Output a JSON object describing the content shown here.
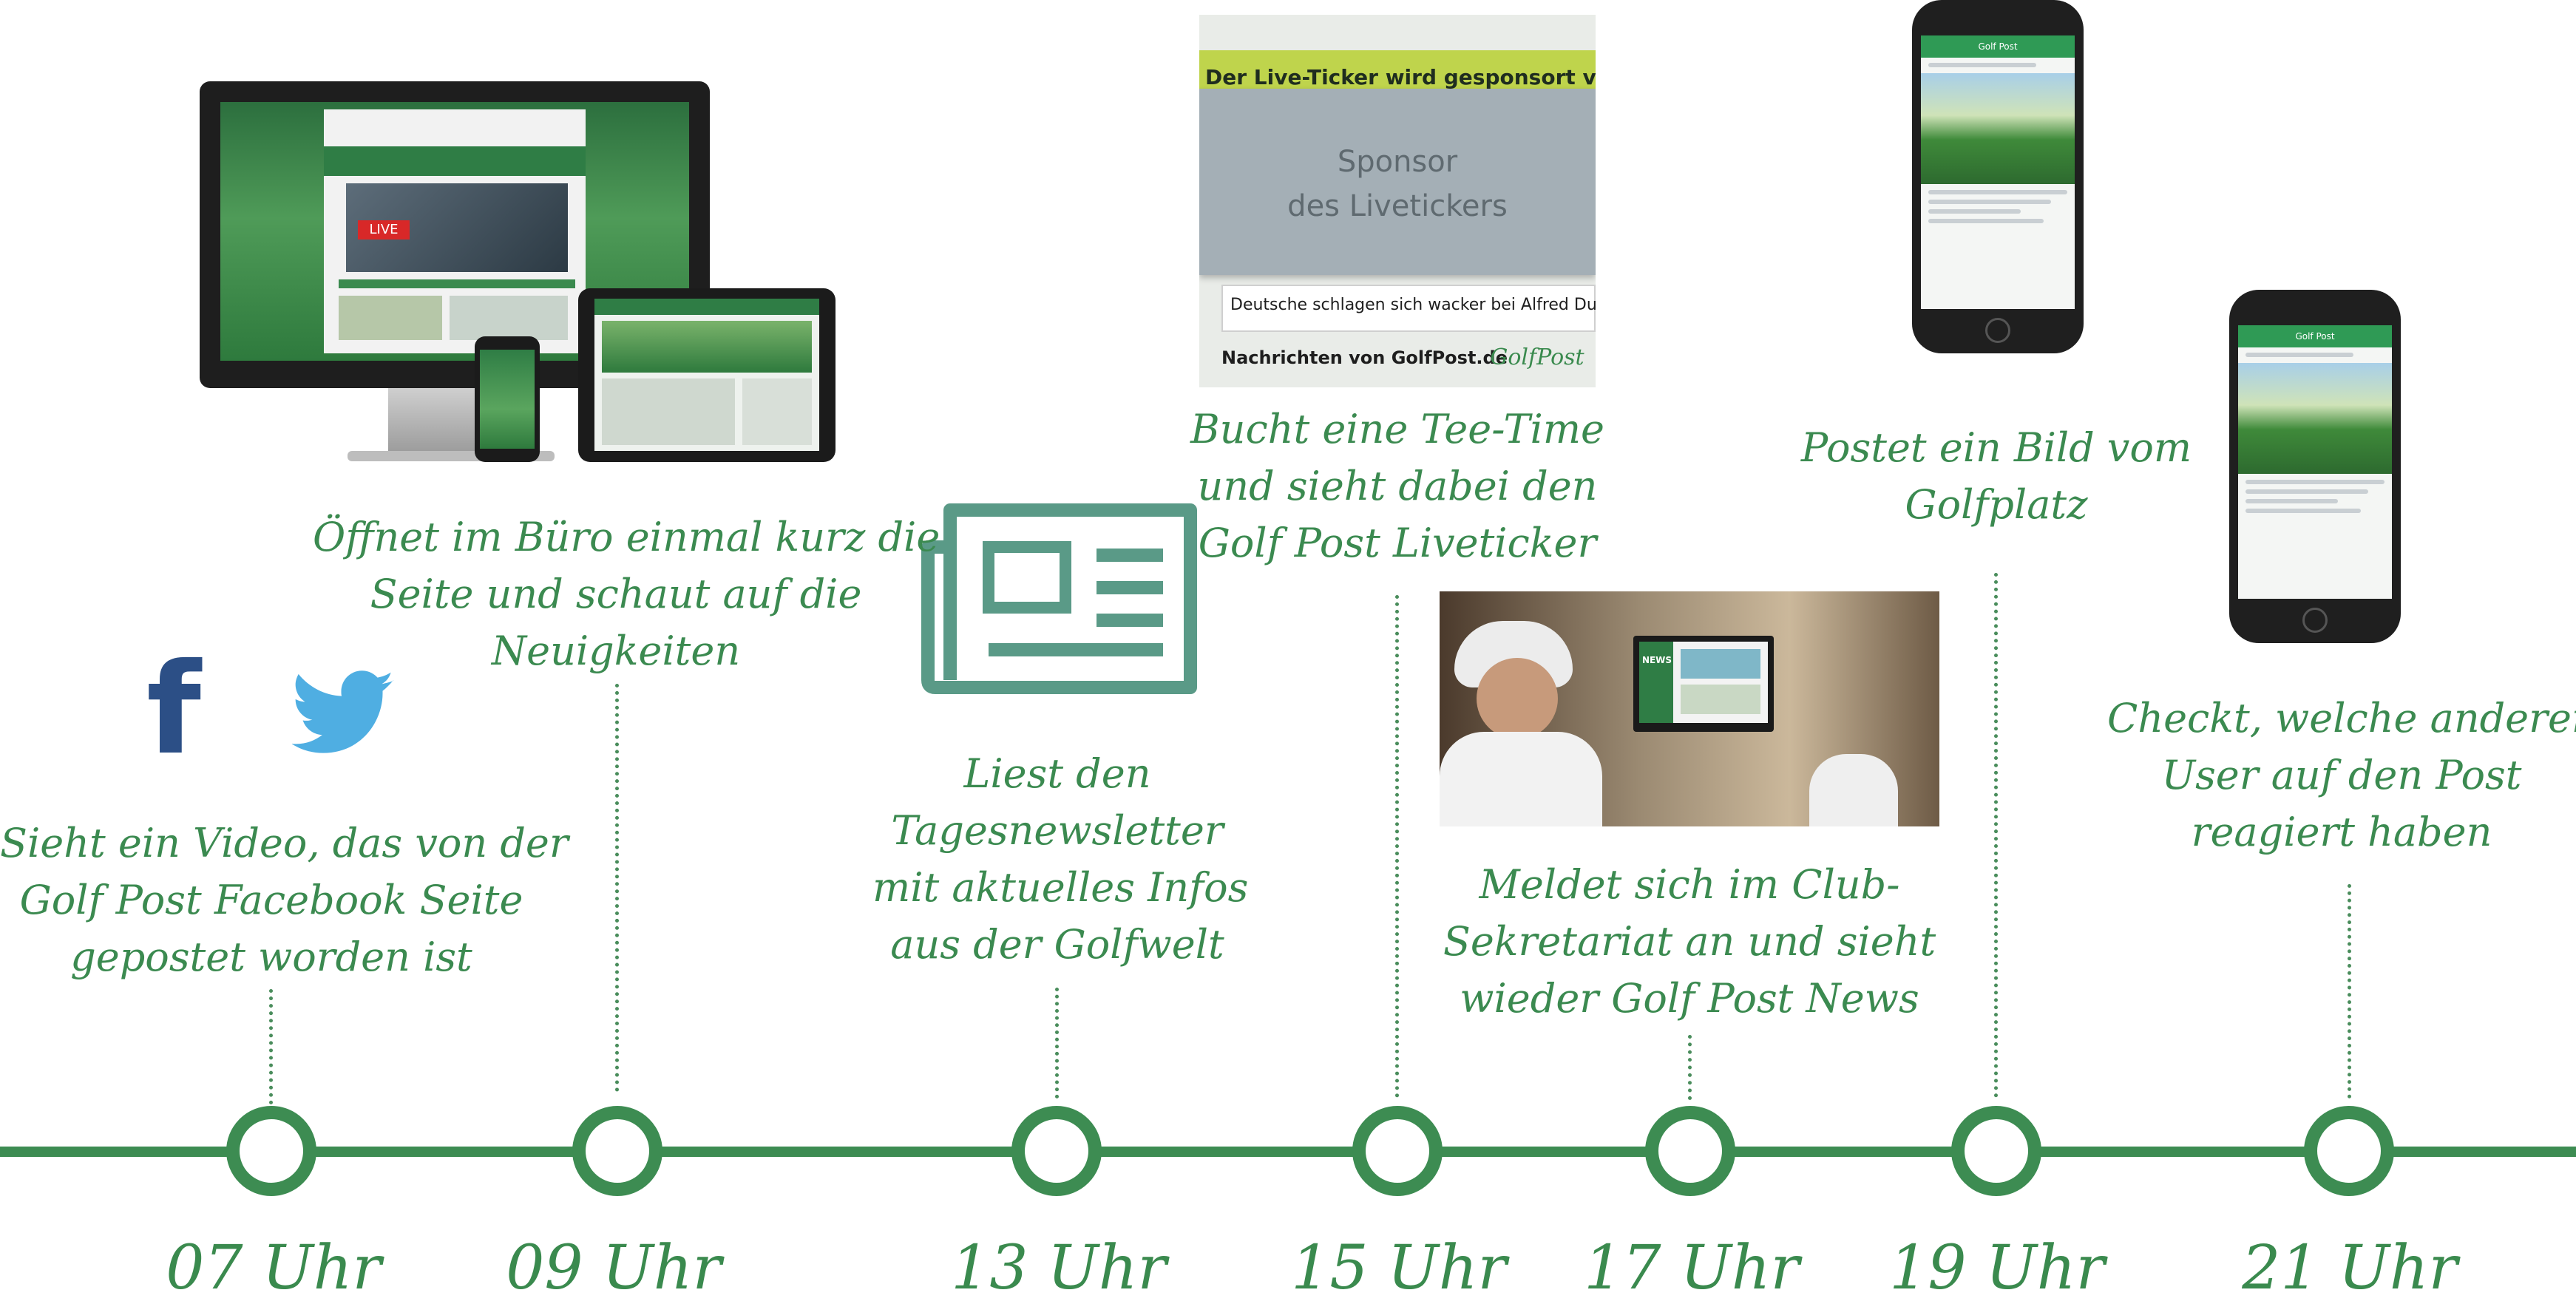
{
  "social": {
    "facebook": "f"
  },
  "captions": {
    "c07": [
      "Sieht ein Video, das von der",
      "Golf Post Facebook Seite",
      "gepostet worden ist"
    ],
    "c09": [
      "Öffnet im Büro einmal kurz die",
      "Seite und schaut auf die",
      "Neuigkeiten"
    ],
    "c13": [
      "Liest den",
      "Tagesnewsletter",
      "mit aktuelles Infos",
      "aus der Golfwelt"
    ],
    "c15": [
      "Bucht eine Tee-Time",
      "und sieht dabei den",
      "Golf Post Liveticker"
    ],
    "c17": [
      "Meldet sich im Club-",
      "Sekretariat an und sieht",
      "wieder Golf Post News"
    ],
    "c19": [
      "Postet ein Bild vom",
      "Golfplatz"
    ],
    "c21": [
      "Checkt, welche anderen",
      "User auf den Post",
      "reagiert haben"
    ]
  },
  "ticker": {
    "banner": "Der Live-Ticker wird gesponsort von",
    "sponsor": [
      "Sponsor",
      "des Livetickers"
    ],
    "headline": "Deutsche schlagen sich wacker bei Alfred Dunhill L",
    "footer": "Nachrichten von GolfPost.de",
    "logo": "GolfPost"
  },
  "tv": {
    "label": "NEWS"
  },
  "phone": {
    "title": "Golf Post"
  },
  "devices": {
    "live_badge": "LIVE"
  },
  "hours": [
    "07 Uhr",
    "09 Uhr",
    "13 Uhr",
    "15 Uhr",
    "17 Uhr",
    "19 Uhr",
    "21 Uhr"
  ],
  "colors": {
    "green": "#3d8c52",
    "text_green": "#3b8a50",
    "facebook": "#2c4f86",
    "twitter": "#4faee2",
    "newspaper": "#5a9a87"
  }
}
